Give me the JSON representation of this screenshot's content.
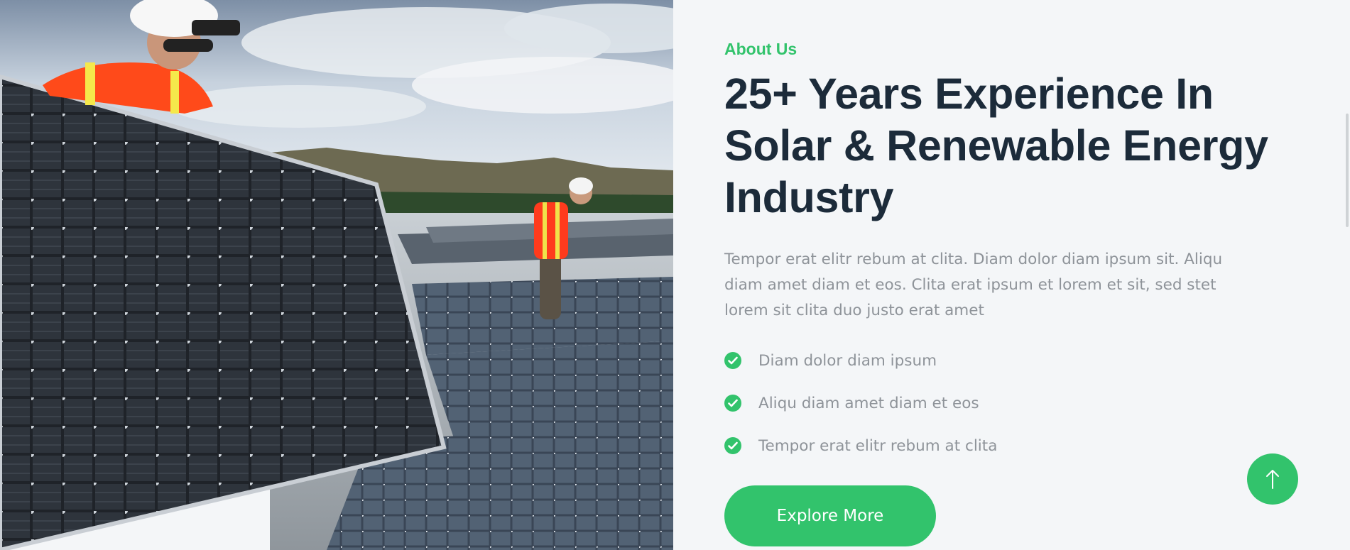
{
  "about": {
    "eyebrow": "About Us",
    "headline_lines": [
      "25+ Years Experience In",
      "Solar & Renewable Energy",
      "Industry"
    ],
    "paragraph": "Tempor erat elitr rebum at clita. Diam dolor diam ipsum sit. Aliqu diam amet diam et eos. Clita erat ipsum et lorem et sit, sed stet lorem sit clita duo justo erat amet",
    "features": [
      "Diam dolor diam ipsum",
      "Aliqu diam amet diam et eos",
      "Tempor erat elitr rebum at clita"
    ],
    "button_label": "Explore More"
  },
  "icons": {
    "feature": "check-circle-icon",
    "scroll_top": "arrow-up-icon"
  },
  "colors": {
    "accent": "#32c36c",
    "heading": "#1c2b3a",
    "body_text": "#8e9399",
    "background": "#f4f6f8"
  }
}
